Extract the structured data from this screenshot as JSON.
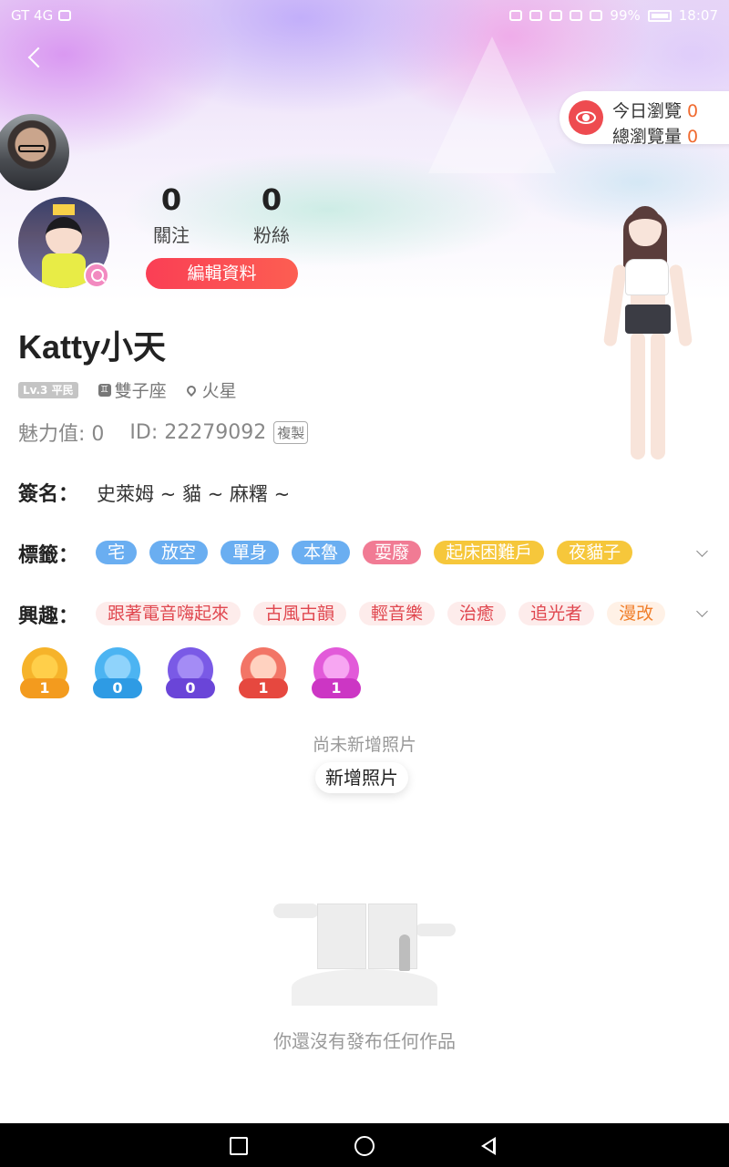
{
  "status_bar": {
    "carrier": "GT 4G",
    "battery": "99%",
    "time": "18:07"
  },
  "views": {
    "today_label": "今日瀏覽",
    "today_count": "0",
    "total_label": "總瀏覽量",
    "total_count": "0"
  },
  "stats": {
    "following_count": "0",
    "following_label": "關注",
    "fans_count": "0",
    "fans_label": "粉絲"
  },
  "edit_profile_label": "編輯資料",
  "profile": {
    "nickname": "Katty小天",
    "level": "Lv.3 平民",
    "zodiac_icon": "♊",
    "zodiac": "雙子座",
    "location": "火星",
    "charm": "魅力值: 0",
    "id": "ID: 22279092",
    "copy_label": "複製"
  },
  "signature": {
    "label": "簽名：",
    "text": "史萊姆 ~ 貓 ~ 麻糬 ~"
  },
  "tags": {
    "label": "標籤：",
    "items": [
      "宅",
      "放空",
      "單身",
      "本魯",
      "耍廢",
      "起床困難戶",
      "夜貓子"
    ]
  },
  "interests": {
    "label": "興趣：",
    "items": [
      "跟著電音嗨起來",
      "古風古韻",
      "輕音樂",
      "治癒",
      "追光者",
      "漫改"
    ]
  },
  "badges": [
    {
      "icon": "crown-badge-icon",
      "count": "1"
    },
    {
      "icon": "document-badge-icon",
      "count": "0"
    },
    {
      "icon": "car-badge-icon",
      "count": "0"
    },
    {
      "icon": "person-badge-icon",
      "count": "1"
    },
    {
      "icon": "microphone-badge-icon",
      "count": "1"
    }
  ],
  "photos": {
    "empty_text": "尚未新增照片",
    "add_label": "新增照片"
  },
  "works": {
    "empty_text": "你還沒有發布任何作品"
  },
  "colors": {
    "accent_red": "#fa3f55",
    "tag_blue": "#6aaef1",
    "tag_pink": "#f17b94",
    "tag_yellow": "#f6c73b",
    "interest_text": "#e0474f",
    "count_orange": "#f06a2f"
  }
}
